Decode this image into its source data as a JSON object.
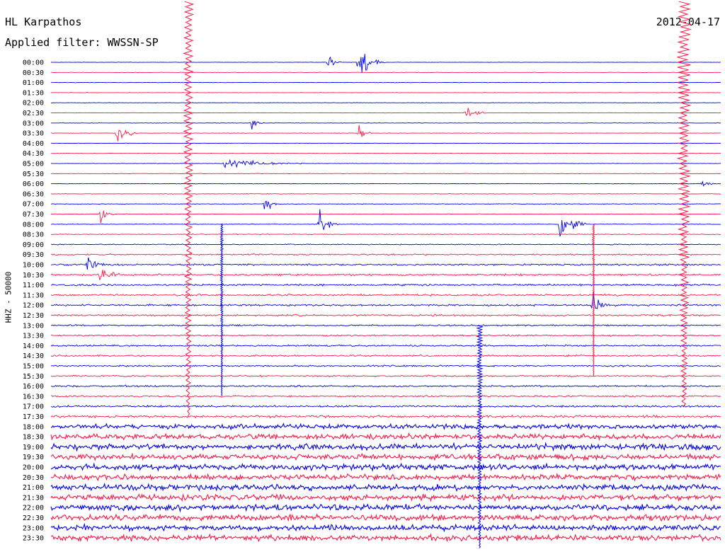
{
  "header": {
    "station": "HL Karpathos",
    "filter": "Applied filter: WWSSN-SP",
    "date": "2012-04-17"
  },
  "channel_label": "HHZ - 50000",
  "colors": {
    "trace_a": "#0000ee",
    "trace_b": "#ff1744"
  },
  "chart_data": {
    "type": "line",
    "title": "HL Karpathos",
    "subtitle": "Applied filter: WWSSN-SP",
    "date": "2012-04-17",
    "ylabel": "HHZ - 50000",
    "row_labels": [
      "00:00",
      "00:30",
      "01:00",
      "01:30",
      "02:00",
      "02:30",
      "03:00",
      "03:30",
      "04:00",
      "04:30",
      "05:00",
      "05:30",
      "06:00",
      "06:30",
      "07:00",
      "07:30",
      "08:00",
      "08:30",
      "09:00",
      "09:30",
      "10:00",
      "10:30",
      "11:00",
      "11:30",
      "12:00",
      "12:30",
      "13:00",
      "13:30",
      "14:00",
      "14:30",
      "15:00",
      "15:30",
      "16:00",
      "16:30",
      "17:00",
      "17:30",
      "18:00",
      "18:30",
      "19:00",
      "19:30",
      "20:00",
      "20:30",
      "21:00",
      "21:30",
      "22:00",
      "22:30",
      "23:00",
      "23:30"
    ],
    "row_noise_level": [
      0.2,
      0.2,
      0.2,
      0.2,
      0.2,
      0.2,
      0.2,
      0.2,
      0.2,
      0.2,
      0.25,
      0.25,
      0.25,
      0.3,
      0.3,
      0.3,
      0.3,
      0.4,
      0.5,
      0.7,
      0.9,
      1.0,
      1.0,
      0.9,
      0.9,
      0.9,
      0.8,
      0.8,
      0.8,
      0.8,
      0.8,
      0.8,
      0.9,
      0.9,
      1.0,
      1.3,
      2.4,
      2.8,
      3.0,
      3.0,
      3.0,
      3.0,
      3.0,
      3.0,
      3.0,
      3.0,
      3.0,
      3.0
    ],
    "events": [
      {
        "row": 0,
        "x": 0.46,
        "amp": 20,
        "dur": 0.04
      },
      {
        "row": 0,
        "x": 0.415,
        "amp": 6,
        "dur": 0.02
      },
      {
        "row": 5,
        "x": 0.62,
        "amp": 10,
        "dur": 0.03
      },
      {
        "row": 6,
        "x": 0.3,
        "amp": 6,
        "dur": 0.02
      },
      {
        "row": 7,
        "x": 0.1,
        "amp": 14,
        "dur": 0.03
      },
      {
        "row": 7,
        "x": 0.46,
        "amp": 10,
        "dur": 0.02
      },
      {
        "row": 10,
        "x": 0.26,
        "amp": 6,
        "dur": 0.12
      },
      {
        "row": 12,
        "x": 0.97,
        "amp": 8,
        "dur": 0.02
      },
      {
        "row": 14,
        "x": 0.32,
        "amp": 14,
        "dur": 0.02
      },
      {
        "row": 15,
        "x": 0.075,
        "amp": 10,
        "dur": 0.02
      },
      {
        "row": 16,
        "x": 0.4,
        "amp": 14,
        "dur": 0.03
      },
      {
        "row": 16,
        "x": 0.76,
        "amp": 20,
        "dur": 0.04
      },
      {
        "row": 20,
        "x": 0.055,
        "amp": 12,
        "dur": 0.03
      },
      {
        "row": 21,
        "x": 0.075,
        "amp": 14,
        "dur": 0.03
      },
      {
        "row": 24,
        "x": 0.81,
        "amp": 14,
        "dur": 0.02
      }
    ],
    "teleseism_spikes": [
      {
        "x": 0.205,
        "from_row": -6,
        "to_row": 35,
        "amp": 14
      },
      {
        "x": 0.255,
        "from_row": 16,
        "to_row": 33,
        "amp": 4
      },
      {
        "x": 0.945,
        "from_row": -6,
        "to_row": 34,
        "amp": 20
      },
      {
        "x": 0.64,
        "from_row": 26,
        "to_row": 48,
        "amp": 8
      },
      {
        "x": 0.81,
        "from_row": 16,
        "to_row": 31,
        "amp": 3
      }
    ]
  }
}
